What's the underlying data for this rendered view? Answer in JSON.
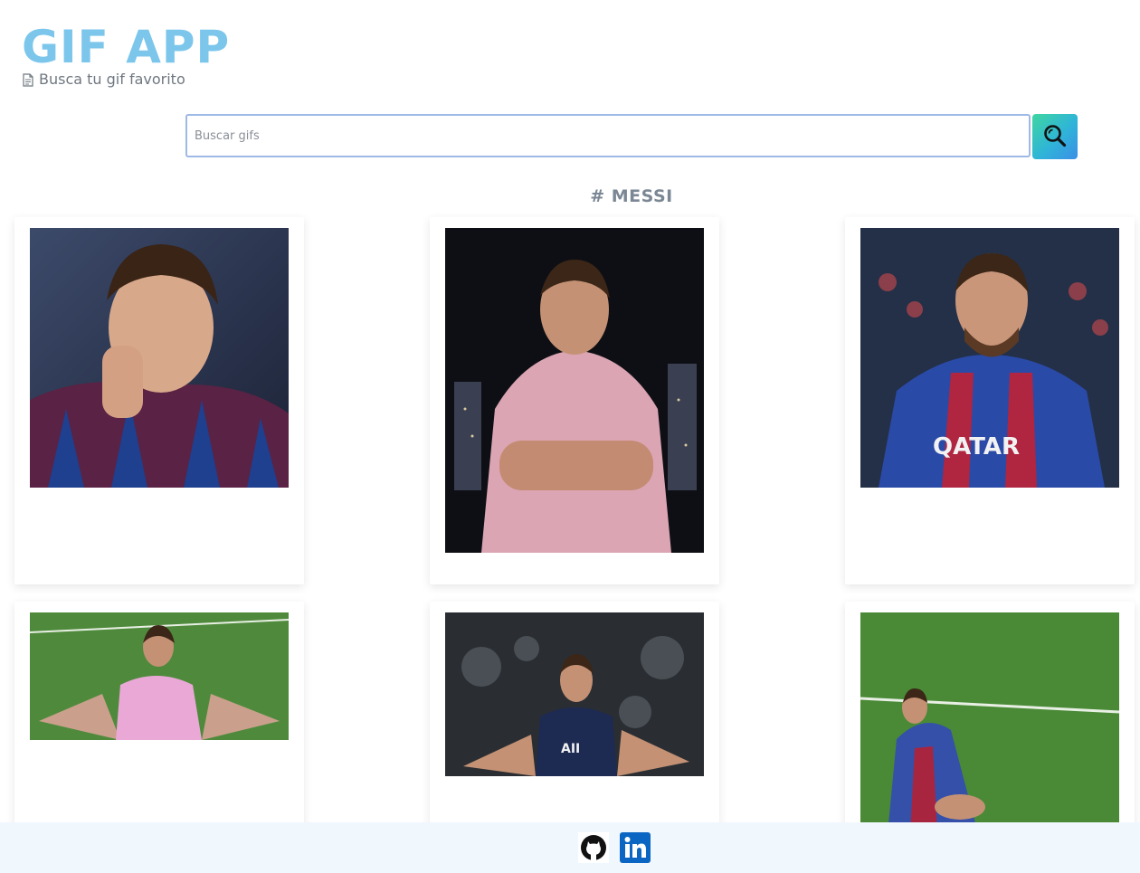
{
  "header": {
    "title": "GIF APP",
    "subtitle_icon": "document-icon",
    "subtitle": "Busca tu gif favorito"
  },
  "search": {
    "placeholder": "Buscar gifs",
    "value": "",
    "button_icon": "search-icon",
    "accent_gradient": [
      "#3fd6a0",
      "#3b8fe6"
    ]
  },
  "category": {
    "label": "# MESSI"
  },
  "gifs": [
    {
      "subject": "Messi in Barcelona shirt pointing"
    },
    {
      "subject": "Messi in pink Inter Miami shirt, arms crossed"
    },
    {
      "subject": "Messi in Barcelona shirt celebrating with hand at ear"
    },
    {
      "subject": "Messi in pink Inter Miami shirt celebrating with arms open"
    },
    {
      "subject": "Messi in dark PSG shirt celebrating with arms open"
    },
    {
      "subject": "Messi in Barcelona shirt sliding on grass"
    }
  ],
  "footer": {
    "links": [
      {
        "icon": "github-icon"
      },
      {
        "icon": "linkedin-icon"
      }
    ]
  },
  "colors": {
    "title": "#7cc6ec",
    "subtitle": "#6f7780",
    "input_border": "#9fb9e6",
    "footer_bg": "#f0f7fd",
    "linkedin": "#0a66c2"
  }
}
